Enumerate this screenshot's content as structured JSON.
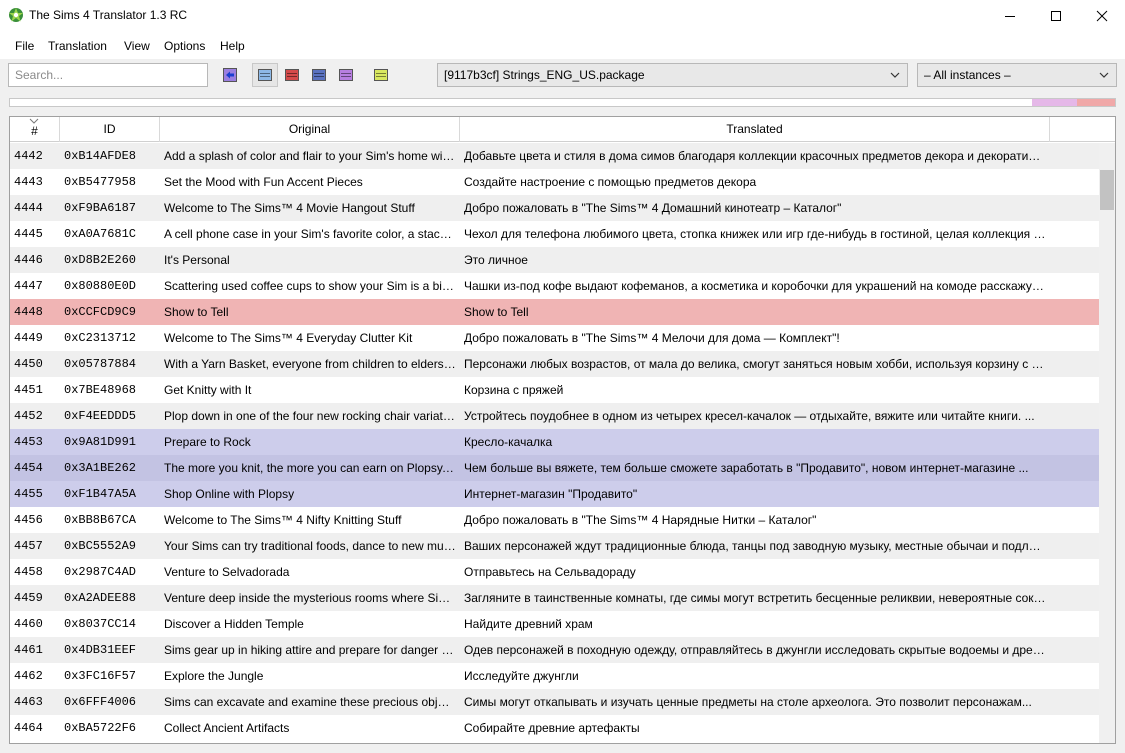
{
  "window": {
    "title": "The Sims 4 Translator 1.3 RC"
  },
  "menu": [
    "File",
    "Translation",
    "View",
    "Options",
    "Help"
  ],
  "toolbar": {
    "search_placeholder": "Search...",
    "package_value": "[9117b3cf] Strings_ENG_US.package",
    "instances_value": "– All instances –"
  },
  "colors": {
    "marked_red": "#f0b4b4",
    "marked_blue": "#cdcdeb",
    "accent": "#2d7d2d"
  },
  "table": {
    "columns": [
      "#",
      "ID",
      "Original",
      "Translated"
    ],
    "rows": [
      {
        "num": "4442",
        "id": "0xB14AFDE8",
        "original": "Add a splash of color and flair to your Sim's home with this collection of colorful decor items and accent pieces.",
        "translated": "Добавьте цвета и стиля в дома симов благодаря коллекции красочных предметов декора и декоративных элементов.",
        "style": "odd"
      },
      {
        "num": "4443",
        "id": "0xB5477958",
        "original": "Set the Mood with Fun Accent Pieces",
        "translated": "Создайте настроение с помощью предметов декора",
        "style": "even"
      },
      {
        "num": "4444",
        "id": "0xF9BA6187",
        "original": "Welcome to The Sims™ 4 Movie Hangout Stuff",
        "translated": "Добро пожаловать в \"The Sims™ 4 Домашний кинотеатр – Каталог\"",
        "style": "odd"
      },
      {
        "num": "4445",
        "id": "0xA0A7681C",
        "original": "A cell phone case in your Sim's favorite color, a stack of books or games somewhere in the living room...",
        "translated": "Чехол для телефона любимого цвета, стопка книжек или игр где-нибудь в гостиной, целая коллекция вещей...",
        "style": "even"
      },
      {
        "num": "4446",
        "id": "0xD8B2E260",
        "original": "It's Personal",
        "translated": "Это личное",
        "style": "odd"
      },
      {
        "num": "4447",
        "id": "0x80880E0D",
        "original": "Scattering used coffee cups to show your Sim is a big coffee drinker, makeup and jewelry boxes on the dresser...",
        "translated": "Чашки из-под кофе выдают кофеманов, а косметика и коробочки для украшений на комоде расскажут о...",
        "style": "even"
      },
      {
        "num": "4448",
        "id": "0xCCFCD9C9",
        "original": "Show to Tell",
        "translated": "Show to Tell",
        "style": "marked-red"
      },
      {
        "num": "4449",
        "id": "0xC2313712",
        "original": "Welcome to The Sims™ 4 Everyday Clutter Kit",
        "translated": "Добро пожаловать в \"The Sims™ 4 Мелочи для дома — Комплект\"!",
        "style": "even"
      },
      {
        "num": "4450",
        "id": "0x05787884",
        "original": "With a Yarn Basket, everyone from children to elders can take up a new hobby...",
        "translated": "Персонажи любых возрастов, от мала до велика, смогут заняться новым хобби, используя корзину с пряжей.",
        "style": "odd"
      },
      {
        "num": "4451",
        "id": "0x7BE48968",
        "original": "Get Knitty with It",
        "translated": "Корзина с пряжей",
        "style": "even"
      },
      {
        "num": "4452",
        "id": "0xF4EEDDD5",
        "original": "Plop down in one of the four new rocking chair variations to relax, knit, or read a book.",
        "translated": "Устройтесь поудобнее в одном из четырех кресел-качалок — отдыхайте, вяжите или читайте книги. ...",
        "style": "odd"
      },
      {
        "num": "4453",
        "id": "0x9A81D991",
        "original": "Prepare to Rock",
        "translated": "Кресло-качалка",
        "style": "marked-blue"
      },
      {
        "num": "4454",
        "id": "0x3A1BE262",
        "original": "The more you knit, the more you can earn on Plopsy, the new online marketplace...",
        "translated": "Чем больше вы вяжете, тем больше сможете заработать в \"Продавито\", новом интернет-магазине ...",
        "style": "marked-blue-sel"
      },
      {
        "num": "4455",
        "id": "0xF1B47A5A",
        "original": "Shop Online with Plopsy",
        "translated": "Интернет-магазин \"Продавито\"",
        "style": "marked-blue"
      },
      {
        "num": "4456",
        "id": "0xBB8B67CA",
        "original": "Welcome to The Sims™ 4 Nifty Knitting Stuff",
        "translated": "Добро пожаловать в \"The Sims™ 4 Нарядные Нитки – Каталог\"",
        "style": "even"
      },
      {
        "num": "4457",
        "id": "0xBC5552A9",
        "original": "Your Sims can try traditional foods, dance to new music, learn local customs...",
        "translated": "Ваших персонажей ждут традиционные блюда, танцы под заводную музыку, местные обычаи и подлинные...",
        "style": "odd"
      },
      {
        "num": "4458",
        "id": "0x2987C4AD",
        "original": "Venture to Selvadorada",
        "translated": "Отправьтесь на Сельвадораду",
        "style": "even"
      },
      {
        "num": "4459",
        "id": "0xA2ADEE88",
        "original": "Venture deep inside the mysterious rooms where Sims might discover priceless relics...",
        "translated": "Загляните в таинственные комнаты, где симы могут встретить бесценные реликвии, невероятные сокровища...",
        "style": "odd"
      },
      {
        "num": "4460",
        "id": "0x8037CC14",
        "original": "Discover a Hidden Temple",
        "translated": "Найдите древний храм",
        "style": "even"
      },
      {
        "num": "4461",
        "id": "0x4DB31EEF",
        "original": "Sims gear up in hiking attire and prepare for danger as they explore hidden waterfalls...",
        "translated": "Одев персонажей в походную одежду, отправляйтесь в джунгли исследовать скрытые водоемы и древние...",
        "style": "odd"
      },
      {
        "num": "4462",
        "id": "0x3FC16F57",
        "original": "Explore the Jungle",
        "translated": "Исследуйте джунгли",
        "style": "even"
      },
      {
        "num": "4463",
        "id": "0x6FFF4006",
        "original": "Sims can excavate and examine these precious objects on the archaeology table...",
        "translated": "Симы могут откапывать и изучать ценные предметы на столе археолога. Это позволит персонажам...",
        "style": "odd"
      },
      {
        "num": "4464",
        "id": "0xBA5722F6",
        "original": "Collect Ancient Artifacts",
        "translated": "Собирайте древние артефакты",
        "style": "even"
      }
    ]
  }
}
